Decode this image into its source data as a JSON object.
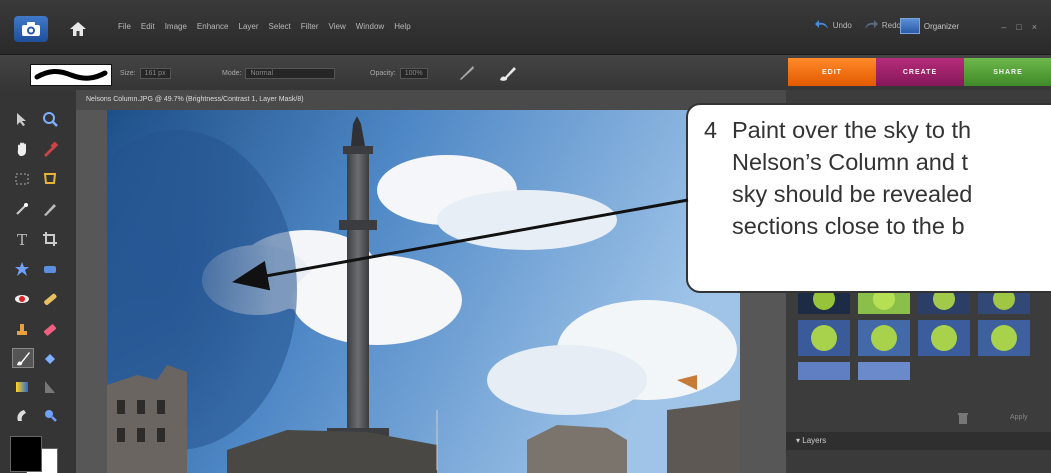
{
  "menubar": {
    "items": [
      "File",
      "Edit",
      "Image",
      "Enhance",
      "Layer",
      "Select",
      "Filter",
      "View",
      "Window",
      "Help"
    ],
    "undo_label": "Undo",
    "redo_label": "Redo",
    "organizer_label": "Organizer",
    "window_controls": [
      "–",
      "□",
      "×"
    ]
  },
  "options": {
    "size_label": "Size:",
    "size_value": "161 px",
    "mode_label": "Mode:",
    "mode_value": "Normal",
    "opacity_label": "Opacity:",
    "opacity_value": "100%"
  },
  "tabs": [
    "EDIT",
    "CREATE",
    "SHARE"
  ],
  "document": {
    "title": "Nelsons Column.JPG @ 49.7% (Brightness/Contrast 1, Layer Mask/8)"
  },
  "panel": {
    "apply_label": "Apply",
    "layers_label": "Layers"
  },
  "callout": {
    "number": "4",
    "line1": "Paint over the sky to th",
    "line2": "Nelson’s Column and t",
    "line3": "sky should be revealed",
    "line4": "sections close to the b"
  },
  "colors": {
    "edit_tab": "#e35a00",
    "create_tab": "#86185a",
    "share_tab": "#3f8a27",
    "app_bg": "#2b2b2b"
  }
}
